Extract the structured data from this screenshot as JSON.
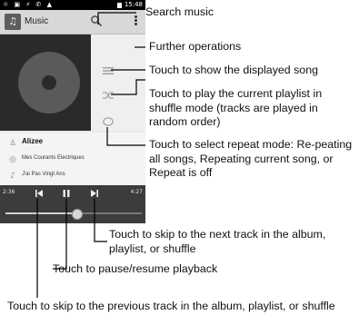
{
  "status": {
    "left_icons": "☼ ▣ ⚡ ✆ ▲",
    "time": "15:48"
  },
  "app": {
    "title": "Music",
    "icon": "music-note-icon"
  },
  "now_playing": {
    "artist": "Alizee",
    "album": "Mes Courants Electriques",
    "song": "J'ai Pas Vingt Ans",
    "elapsed": "2:36",
    "total": "4:27",
    "progress": 0.52
  },
  "callouts": {
    "search": "Search music",
    "more": "Further operations",
    "show_song": "Touch to show the displayed song",
    "shuffle": "Touch to play the current playlist in shuffle mode (tracks are played in random order)",
    "repeat": "Touch to select repeat mode: Re-peating all songs, Repeating current song, or Repeat is off",
    "next": "Touch to skip to the next track in the album, playlist, or shuffle",
    "pause": "Touch to pause/resume playback",
    "previous": "Touch to skip to the previous track in the album, playlist, or shuffle"
  }
}
